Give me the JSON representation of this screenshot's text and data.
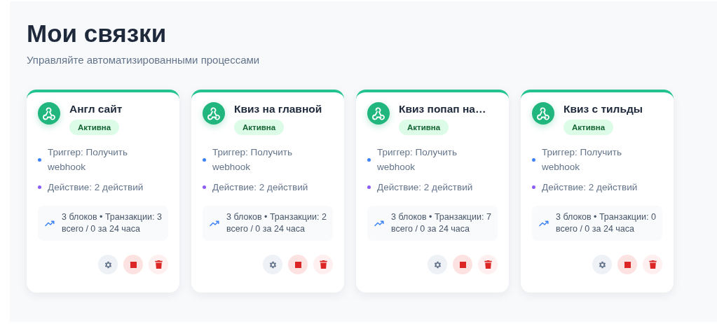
{
  "header": {
    "title": "Мои связки",
    "subtitle": "Управляйте автоматизированными процессами"
  },
  "cards": [
    {
      "name": "Англ сайт",
      "status": "Активна",
      "active": true,
      "details": [
        {
          "text": "Триггер: Получить webhook",
          "color": "#3b82f6"
        },
        {
          "text": "Действие: 2 действий",
          "color": "#8b5cf6"
        }
      ],
      "stats": "3 блоков • Транзакции: 3 всего / 0 за 24 часа"
    },
    {
      "name": "Квиз на главной",
      "status": "Активна",
      "active": true,
      "details": [
        {
          "text": "Триггер: Получить webhook",
          "color": "#3b82f6"
        },
        {
          "text": "Действие: 2 действий",
          "color": "#8b5cf6"
        }
      ],
      "stats": "3 блоков • Транзакции: 2 всего / 0 за 24 часа"
    },
    {
      "name": "Квиз попап на…",
      "status": "Активна",
      "active": true,
      "details": [
        {
          "text": "Триггер: Получить webhook",
          "color": "#3b82f6"
        },
        {
          "text": "Действие: 2 действий",
          "color": "#8b5cf6"
        }
      ],
      "stats": "3 блоков • Транзакции: 7 всего / 0 за 24 часа"
    },
    {
      "name": "Квиз с тильды",
      "status": "Активна",
      "active": true,
      "details": [
        {
          "text": "Триггер: Получить webhook",
          "color": "#3b82f6"
        },
        {
          "text": "Действие: 2 действий",
          "color": "#8b5cf6"
        }
      ],
      "stats": "3 блоков • Транзакции: 0 всего / 0 за 24 часа"
    }
  ]
}
